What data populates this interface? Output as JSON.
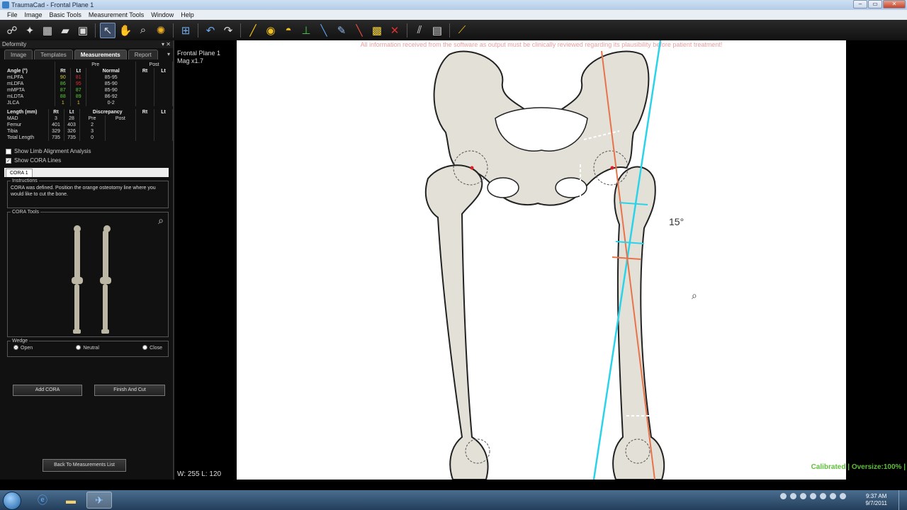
{
  "window": {
    "title": "TraumaCad - Frontal Plane 1",
    "controls": [
      "–",
      "▭",
      "✕"
    ]
  },
  "menu": [
    "File",
    "Image",
    "Basic Tools",
    "Measurement Tools",
    "Window",
    "Help"
  ],
  "panel": {
    "title": "Deformity",
    "tabs": [
      "Image",
      "Templates",
      "Measurements",
      "Report"
    ],
    "active_tab": "Measurements",
    "angle_table": {
      "group_labels": {
        "pre": "Pre",
        "post": "Post"
      },
      "headers": [
        "Angle (°)",
        "Rt",
        "Lt",
        "Normal",
        "Rt",
        "Lt"
      ],
      "rows": [
        {
          "name": "mLPFA",
          "rt": "90",
          "lt": "81",
          "normal": "85-95"
        },
        {
          "name": "mLDFA",
          "rt": "86",
          "lt": "95",
          "normal": "85-90"
        },
        {
          "name": "mMPTA",
          "rt": "87",
          "lt": "87",
          "normal": "85-90"
        },
        {
          "name": "mLDTA",
          "rt": "88",
          "lt": "89",
          "normal": "86-92"
        },
        {
          "name": "JLCA",
          "rt": "1",
          "lt": "1",
          "normal": "0-2"
        }
      ]
    },
    "length_table": {
      "headers": [
        "Length (mm)",
        "Rt",
        "Lt",
        "Discrepancy",
        "Rt",
        "Lt"
      ],
      "subheaders": [
        "Pre",
        "Post"
      ],
      "rows": [
        {
          "name": "MAD",
          "rt": "3",
          "lt": "28",
          "disc": ""
        },
        {
          "name": "Femur",
          "rt": "401",
          "lt": "403",
          "disc": "2"
        },
        {
          "name": "Tibia",
          "rt": "329",
          "lt": "326",
          "disc": "3"
        },
        {
          "name": "Total Length",
          "rt": "735",
          "lt": "735",
          "disc": "0"
        }
      ]
    },
    "checks": [
      {
        "label": "Show Limb Alignment Analysis",
        "checked": false
      },
      {
        "label": "Show CORA Lines",
        "checked": true
      }
    ],
    "cora_tab": "CORA 1",
    "instructions_title": "Instructions",
    "instructions_text": "CORA was defined. Position the orange osteotomy line where you would like to cut the bone.",
    "cora_tools_title": "CORA Tools",
    "wedge": {
      "title": "Wedge",
      "options": [
        "Open",
        "Neutral",
        "Close"
      ],
      "selected": "Open"
    },
    "buttons": {
      "add_cora": "Add CORA",
      "finish_cut": "Finish And Cut",
      "back": "Back To Measurements List"
    }
  },
  "viewport": {
    "plane": "Frontal Plane 1",
    "mag": "Mag x1.7",
    "disclaimer": "All information received from the software as output must be clinically reviewed regarding its plausibility before patient treatment!",
    "angle_label": "15°",
    "window_level": "W: 255 L: 120",
    "calibration": "Calibrated | Oversize:100% |"
  },
  "taskbar": {
    "time": "9:37 AM",
    "date": "9/7/2011"
  },
  "colors": {
    "cyan_line": "#29d3ea",
    "orange_line": "#e8734a",
    "bone": "#e2e0d7",
    "bone_outline": "#222222"
  },
  "icons": [
    "start-orb-icon",
    "ie-icon",
    "folder-icon",
    "traumacad-icon"
  ]
}
